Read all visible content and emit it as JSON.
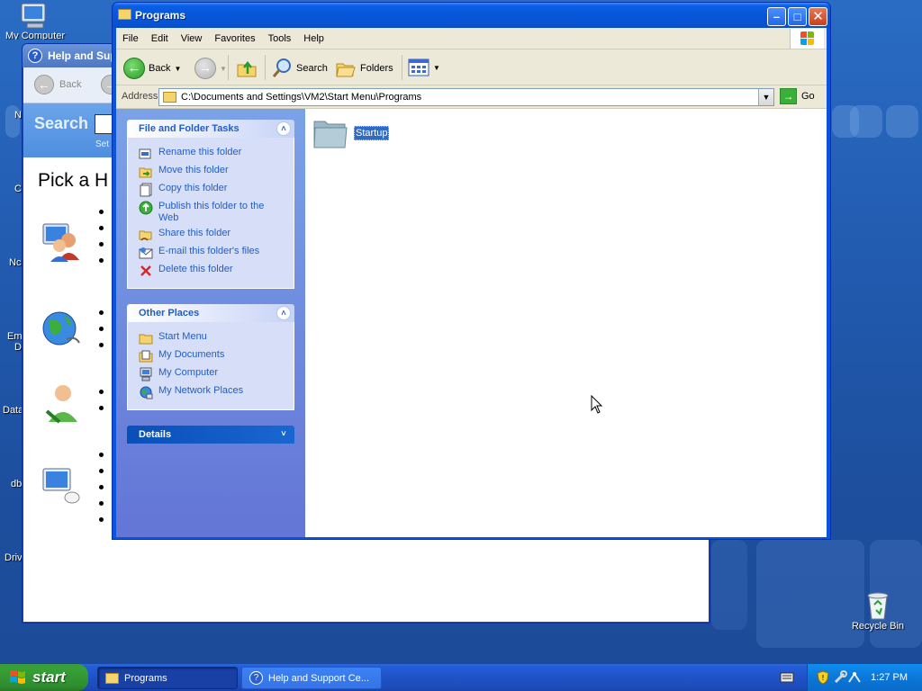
{
  "desktop": {
    "icons": [
      {
        "label": "My Computer"
      },
      {
        "label": "Recycle Bin"
      }
    ],
    "partial_labels": [
      "N",
      "C",
      "Nc",
      "Em",
      "D",
      "Data",
      "db",
      "Driv"
    ]
  },
  "help_window": {
    "title": "Help and Supp",
    "back_label": "Back",
    "search_label": "Search",
    "set_label": "Set a",
    "pick_heading": "Pick a H"
  },
  "explorer": {
    "title": "Programs",
    "menu": [
      "File",
      "Edit",
      "View",
      "Favorites",
      "Tools",
      "Help"
    ],
    "toolbar": {
      "back": "Back",
      "search": "Search",
      "folders": "Folders"
    },
    "address": {
      "label": "Address",
      "path": "C:\\Documents and Settings\\VM2\\Start Menu\\Programs",
      "go": "Go"
    },
    "tasks": {
      "file_folder": {
        "title": "File and Folder Tasks",
        "items": [
          {
            "label": "Rename this folder",
            "icon": "rename-icon"
          },
          {
            "label": "Move this folder",
            "icon": "move-icon"
          },
          {
            "label": "Copy this folder",
            "icon": "copy-icon"
          },
          {
            "label": "Publish this folder to the Web",
            "icon": "publish-icon"
          },
          {
            "label": "Share this folder",
            "icon": "share-icon"
          },
          {
            "label": "E-mail this folder's files",
            "icon": "email-icon"
          },
          {
            "label": "Delete this folder",
            "icon": "delete-icon"
          }
        ]
      },
      "other_places": {
        "title": "Other Places",
        "items": [
          {
            "label": "Start Menu",
            "icon": "folder-icon"
          },
          {
            "label": "My Documents",
            "icon": "documents-icon"
          },
          {
            "label": "My Computer",
            "icon": "computer-icon"
          },
          {
            "label": "My Network Places",
            "icon": "network-icon"
          }
        ]
      },
      "details": {
        "title": "Details"
      }
    },
    "files": [
      {
        "name": "Startup",
        "selected": true
      }
    ]
  },
  "taskbar": {
    "start": "start",
    "tasks": [
      {
        "label": "Programs",
        "active": true
      },
      {
        "label": "Help and Support Ce...",
        "active": false
      }
    ],
    "clock": "1:27 PM"
  },
  "colors": {
    "title_blue": "#0752d2",
    "task_link": "#215dc6",
    "start_green": "#2f8e2f",
    "selection": "#316ac5"
  }
}
